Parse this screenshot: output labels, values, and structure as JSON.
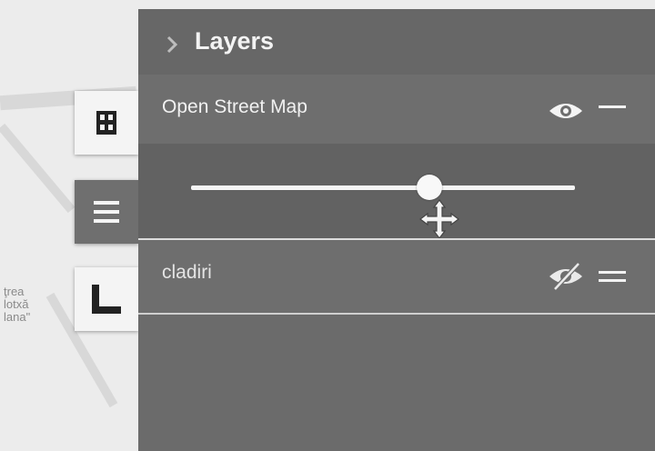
{
  "map": {
    "label_lines": [
      "ţrea",
      "lotxă",
      "lana\""
    ]
  },
  "toolbar": {
    "buttons": [
      {
        "icon": "grid-icon"
      },
      {
        "icon": "layers-list-icon",
        "active": true
      },
      {
        "icon": "measure-icon"
      }
    ]
  },
  "panel": {
    "title": "Layers",
    "collapse_icon": "chevron-right-icon",
    "layers": [
      {
        "name": "Open Street Map",
        "visible": true,
        "opacity": 0.62
      },
      {
        "name": "cladiri",
        "visible": false
      }
    ]
  },
  "colors": {
    "panel_bg": "#6b6b6b",
    "active_button": "#6f6f6f",
    "text": "#f1f1f1"
  }
}
